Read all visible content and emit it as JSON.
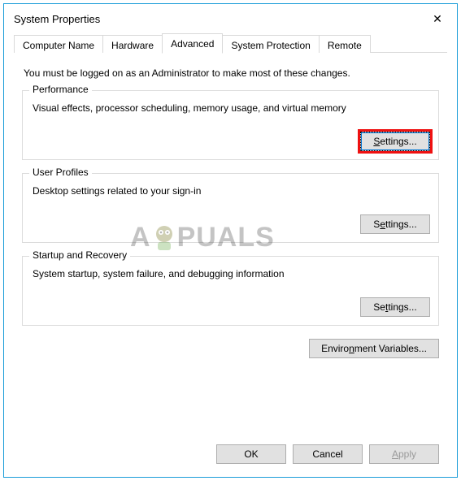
{
  "window": {
    "title": "System Properties"
  },
  "tabs": {
    "computer_name": "Computer Name",
    "hardware": "Hardware",
    "advanced": "Advanced",
    "system_protection": "System Protection",
    "remote": "Remote"
  },
  "content": {
    "intro": "You must be logged on as an Administrator to make most of these changes.",
    "performance": {
      "legend": "Performance",
      "desc": "Visual effects, processor scheduling, memory usage, and virtual memory",
      "button": "Settings..."
    },
    "user_profiles": {
      "legend": "User Profiles",
      "desc": "Desktop settings related to your sign-in",
      "button": "Settings..."
    },
    "startup": {
      "legend": "Startup and Recovery",
      "desc": "System startup, system failure, and debugging information",
      "button": "Settings..."
    },
    "env_button": "Environment Variables..."
  },
  "dialog_buttons": {
    "ok": "OK",
    "cancel": "Cancel",
    "apply": "Apply"
  },
  "watermark": {
    "text_left": "A",
    "text_right": "PUALS"
  }
}
